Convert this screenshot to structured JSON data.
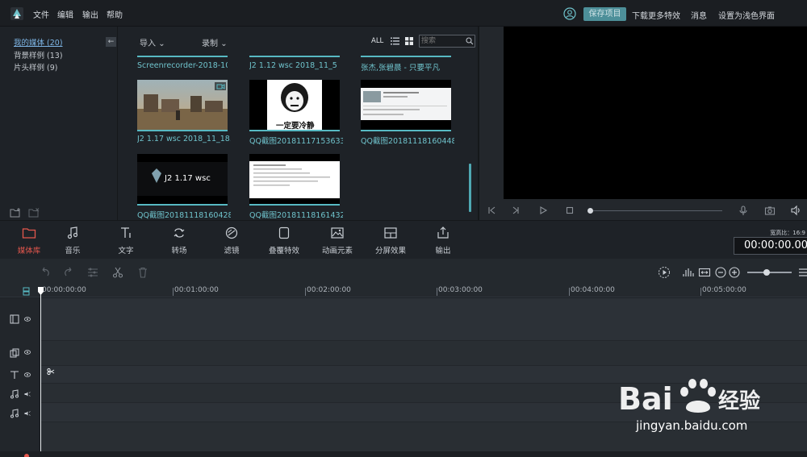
{
  "menubar": {
    "items": [
      "文件",
      "编辑",
      "输出",
      "帮助"
    ],
    "save_project": "保存项目",
    "download_effects": "下载更多特效",
    "messages": "消息",
    "light_theme": "设置为浅色界面"
  },
  "library": {
    "categories": [
      {
        "label": "我的媒体 (20)"
      },
      {
        "label": "背景样例 (13)"
      },
      {
        "label": "片头样例 (9)"
      }
    ],
    "collapse": "←",
    "import_label": "导入",
    "record_label": "录制",
    "filter_all": "ALL",
    "search_placeholder": "搜索",
    "top_row_labels": [
      "Screenrecorder-2018-10...",
      "J2 1.12 wsc 2018_11_5 1...",
      "张杰,张碧晨 - 只要平凡"
    ],
    "items": [
      {
        "label": "J2 1.17 wsc 2018_11_18..."
      },
      {
        "label": "QQ截图20181117153633",
        "overlay_text": "一定要冷静"
      },
      {
        "label": "QQ截图20181118160448"
      },
      {
        "label": "QQ截图20181118160428",
        "overlay_text": "J2 1.17 wsc"
      },
      {
        "label": "QQ截图20181118161432"
      }
    ]
  },
  "tools": [
    {
      "label": "媒体库",
      "icon": "folder-icon"
    },
    {
      "label": "音乐",
      "icon": "music-icon"
    },
    {
      "label": "文字",
      "icon": "text-icon"
    },
    {
      "label": "转场",
      "icon": "transition-icon"
    },
    {
      "label": "滤镜",
      "icon": "filter-icon"
    },
    {
      "label": "叠覆特效",
      "icon": "overlay-icon"
    },
    {
      "label": "动画元素",
      "icon": "elements-icon"
    },
    {
      "label": "分屏效果",
      "icon": "split-screen-icon"
    },
    {
      "label": "输出",
      "icon": "export-icon"
    }
  ],
  "aspect_label": "宽高比：16:9",
  "timecode": "00:00:00.00",
  "ruler": [
    "00:00:00:00",
    "00:01:00:00",
    "00:02:00:00",
    "00:03:00:00",
    "00:04:00:00",
    "00:05:00:00"
  ],
  "colors": {
    "accent": "#57b9c3",
    "active_tool": "#e4574d",
    "save_button": "#4d8f99"
  },
  "watermark": {
    "text": "jingyan.baidu.com",
    "logo": "Baidu经验"
  }
}
